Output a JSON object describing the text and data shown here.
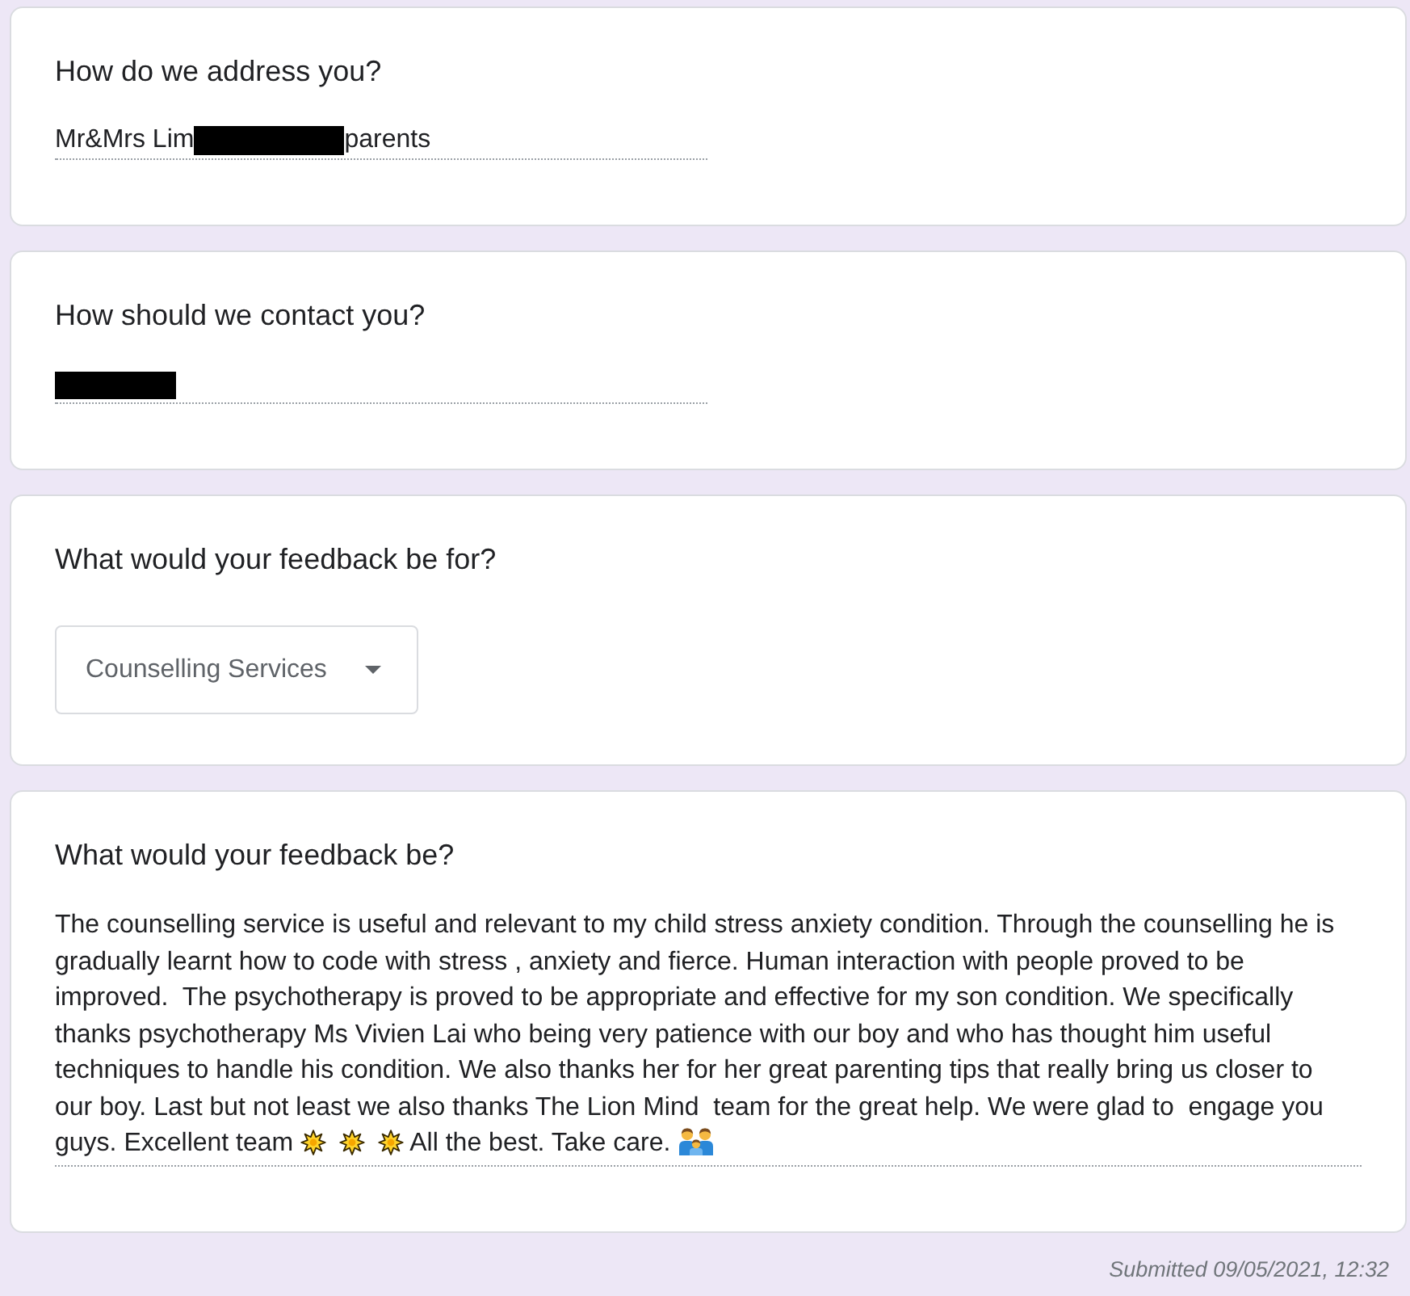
{
  "questions": [
    {
      "kind": "short_answer",
      "title": "How do we address you?",
      "answer": [
        {
          "kind": "text",
          "text": "Mr&Mrs Lim"
        },
        {
          "kind": "redacted"
        },
        {
          "kind": "text",
          "text": "parents"
        }
      ]
    },
    {
      "kind": "short_answer",
      "title": "How should we contact you?",
      "answer": [
        {
          "kind": "redacted"
        }
      ]
    },
    {
      "kind": "dropdown",
      "title": "What would your feedback be for?",
      "value": "Counselling Services"
    },
    {
      "kind": "paragraph",
      "title": "What would your feedback be?",
      "answer": [
        {
          "kind": "text",
          "text": "The counselling service is useful and relevant to my child stress anxiety condition. Through the counselling he is gradually learnt how to code with stress , anxiety and fierce. Human interaction with people proved to be improved.  The psychotherapy is proved to be appropriate and effective for my son condition. We specifically thanks psychotherapy Ms Vivien Lai who being very patience with our boy and who has thought him useful techniques to handle his condition. We also thanks her for her great parenting tips that really bring us closer to our boy. Last but not least we also thanks The Lion Mind  team for the great help. We were glad to  engage you guys. Excellent team"
        },
        {
          "kind": "starburst"
        },
        {
          "kind": "starburst"
        },
        {
          "kind": "starburst"
        },
        {
          "kind": "text",
          "text": "All the best. Take care."
        },
        {
          "kind": "family"
        }
      ]
    }
  ],
  "footer": {
    "submitted": "Submitted 09/05/2021, 12:32"
  }
}
